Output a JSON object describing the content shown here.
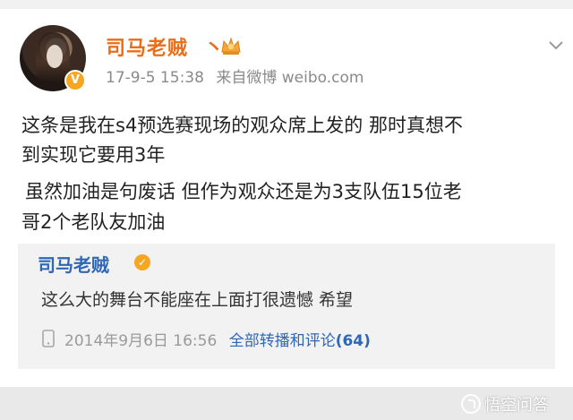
{
  "post": {
    "username": "司马老贼",
    "username_tail": "丶",
    "time": "17-9-5 15:38",
    "source": "来自微博 weibo.com",
    "lines": [
      "这条是我在s4预选赛现场的观众席上发的  那时真想不",
      "到实现它要用3年",
      "  虽然加油是句废话 但作为观众还是为3支队伍15位老",
      "哥2个老队友加油"
    ]
  },
  "quoted": {
    "username": "司马老贼",
    "text": "这么大的舞台不能座在上面打很遗憾 希望",
    "time": "2014年9月6日 16:56",
    "repost_label": "全部转播和评论",
    "repost_count": "(64)"
  },
  "watermark": {
    "text": "悟空问答"
  },
  "icons": {
    "avatar": "avatar-image",
    "verified": "verified-badge-icon",
    "crown": "crown-icon",
    "chevron": "chevron-down-icon",
    "phone": "phone-icon"
  },
  "colors": {
    "username": "#e96e1a",
    "link": "#2f67b7",
    "badge": "#f5a623"
  }
}
